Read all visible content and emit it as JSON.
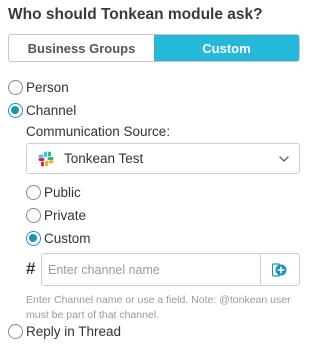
{
  "title": "Who should Tonkean module ask?",
  "toggle": {
    "options": [
      "Business Groups",
      "Custom"
    ],
    "selected": "Custom"
  },
  "recipient": {
    "options": [
      "Person",
      "Channel"
    ],
    "selected": "Channel"
  },
  "communication_source": {
    "label": "Communication Source:",
    "value": "Tonkean Test",
    "icon": "slack-icon"
  },
  "channel_type": {
    "options": [
      "Public",
      "Private",
      "Custom"
    ],
    "selected": "Custom"
  },
  "channel_input": {
    "prefix": "#",
    "value": "",
    "placeholder": "Enter channel name",
    "field_button_icon": "insert-field-icon"
  },
  "help_text": "Enter Channel name or use a field. Note: @tonkean user must be part of that channel.",
  "reply_in_thread": {
    "label": "Reply in Thread",
    "checked": false
  },
  "colors": {
    "accent": "#25b8d8",
    "radio_checked": "#1e93b1",
    "help_text": "#9a9a9a"
  }
}
